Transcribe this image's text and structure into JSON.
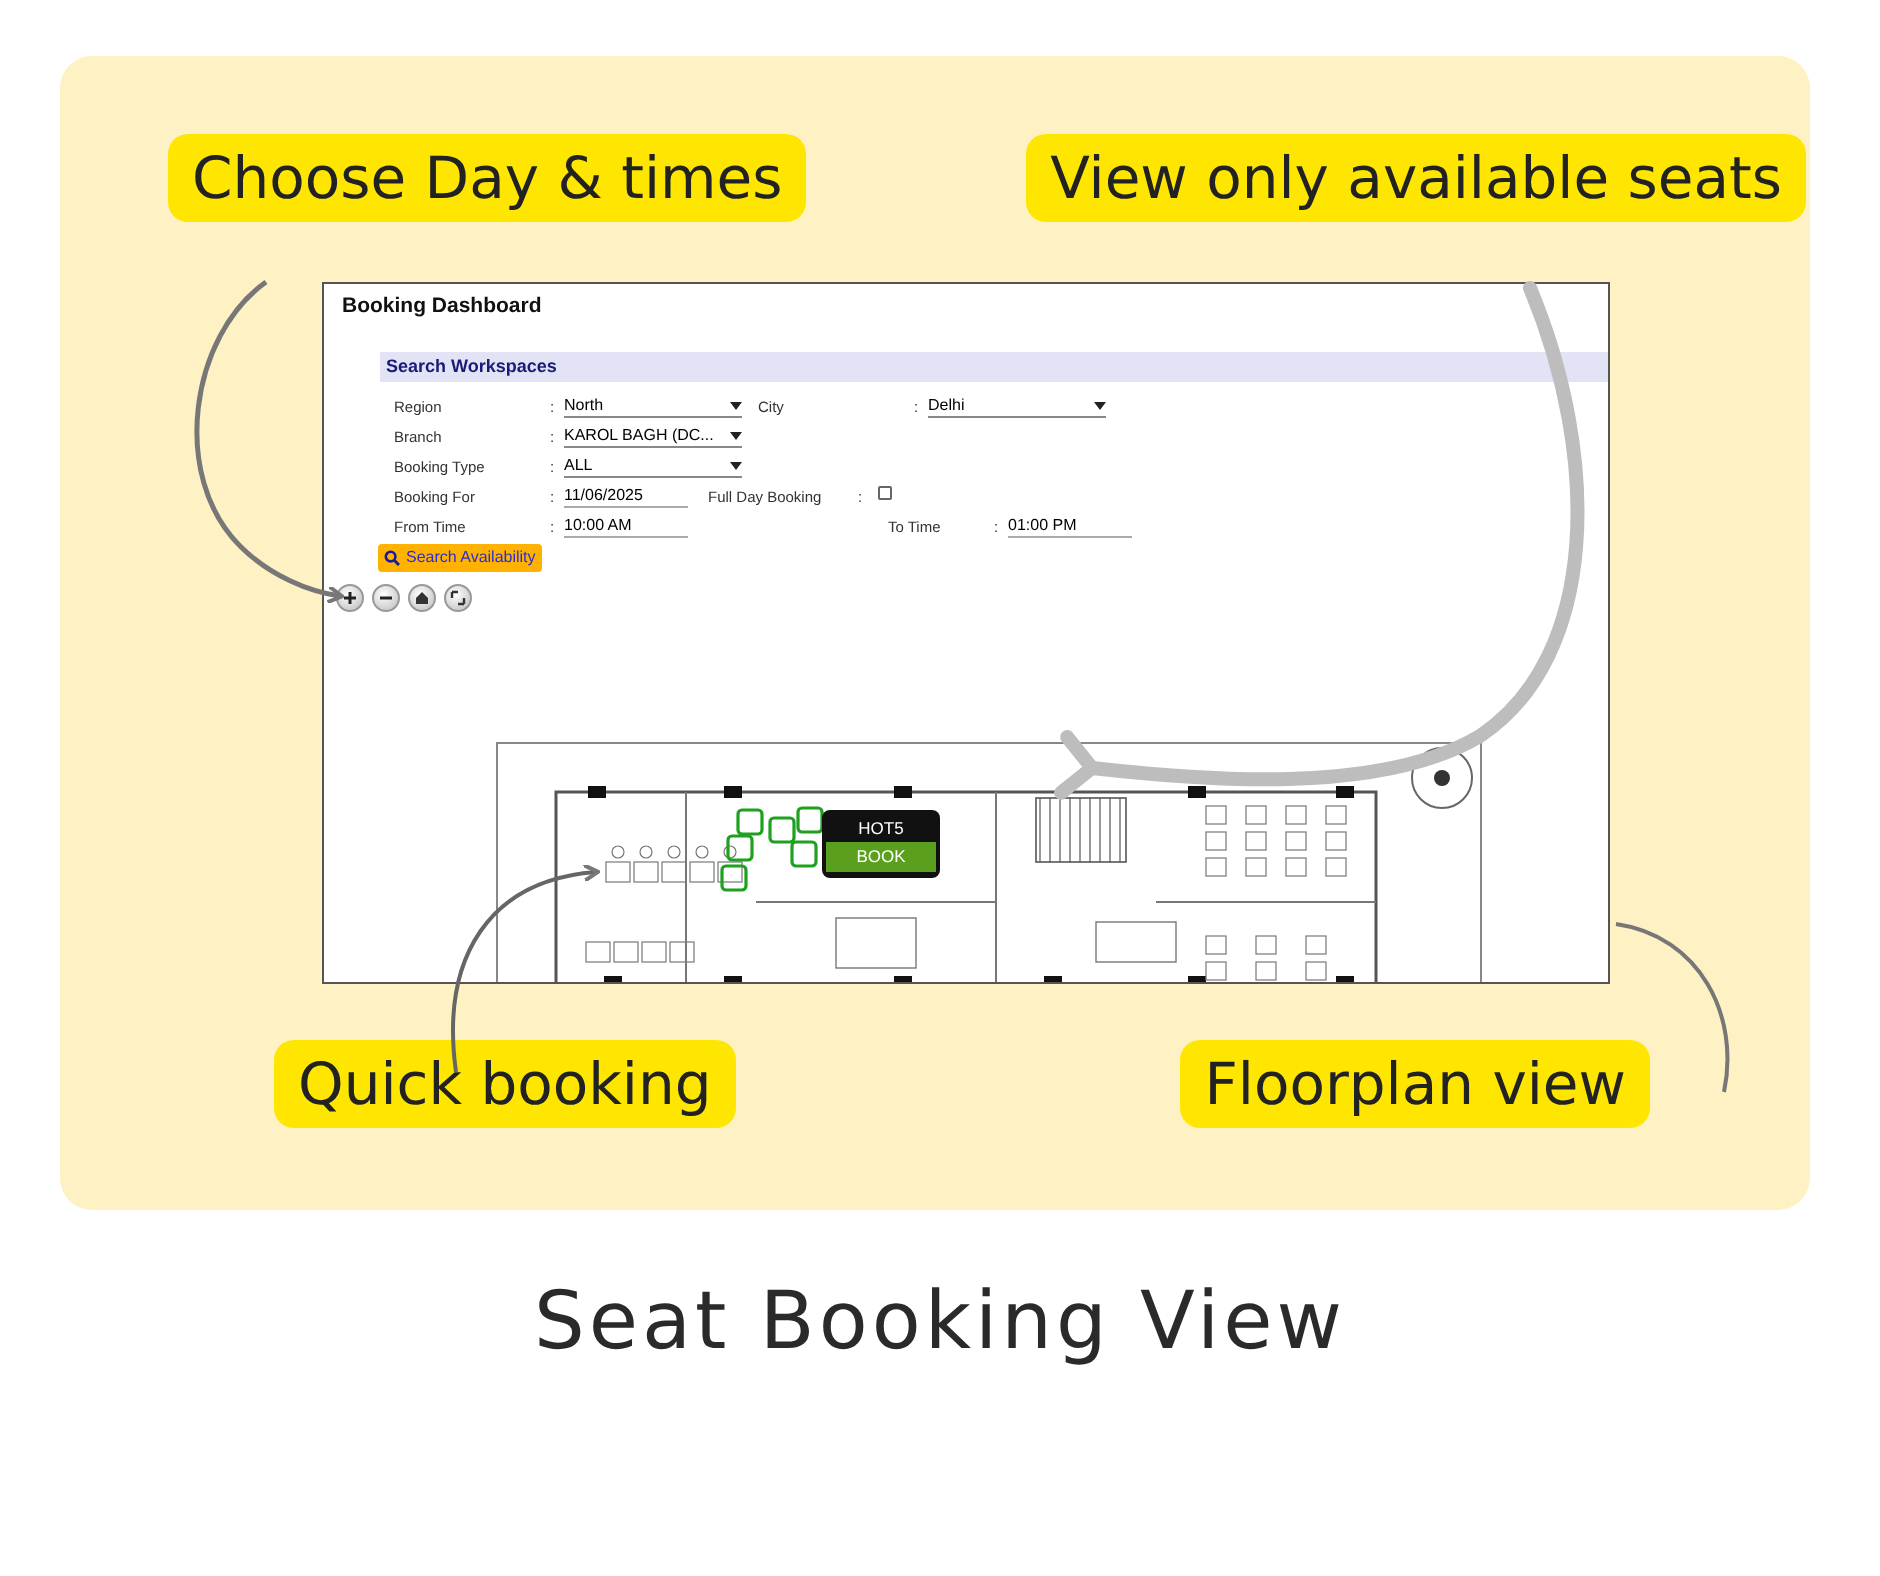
{
  "callouts_top": [
    {
      "text": "Choose Day & times"
    },
    {
      "text": "View only available seats"
    }
  ],
  "dashboard": {
    "title": "Booking Dashboard",
    "section": "Search Workspaces",
    "rows": [
      [
        {
          "label": "Region",
          "sep": ":",
          "kind": "select",
          "value": "North"
        },
        {
          "label": "City",
          "sep": ":",
          "kind": "select",
          "value": "Delhi"
        }
      ],
      [
        {
          "label": "Branch",
          "sep": ":",
          "kind": "select",
          "value": "KAROL BAGH (DC..."
        }
      ],
      [
        {
          "label": "Booking Type",
          "sep": ":",
          "kind": "select",
          "value": "ALL"
        }
      ],
      [
        {
          "label": "Booking For",
          "sep": ":",
          "kind": "text",
          "value": "11/06/2025"
        },
        {
          "label": "Full Day Booking",
          "sep": ":",
          "kind": "checkbox",
          "checked": false
        }
      ],
      [
        {
          "label": "From Time",
          "sep": ":",
          "kind": "text",
          "value": "10:00 AM"
        },
        {
          "label": "To Time",
          "sep": ":",
          "kind": "text",
          "value": "01:00 PM"
        }
      ]
    ],
    "search_button": "Search Availability",
    "popup": {
      "seat": "HOT5",
      "action": "BOOK"
    }
  },
  "callouts_bottom": [
    {
      "text": "Quick booking"
    },
    {
      "text": "Floorplan view"
    }
  ],
  "caption": "Seat Booking View"
}
